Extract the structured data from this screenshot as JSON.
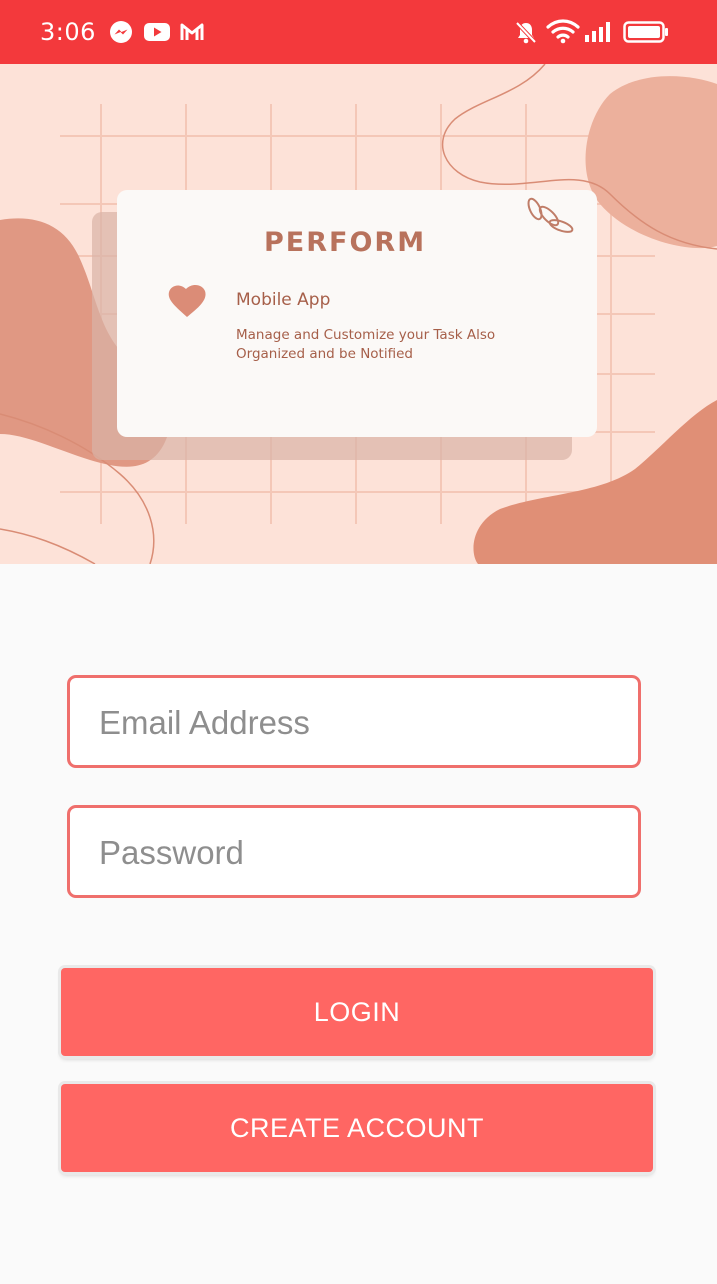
{
  "status_bar": {
    "time": "3:06",
    "background": "#f3393c",
    "notification_icons": [
      "messenger-icon",
      "youtube-icon",
      "gmail-icon"
    ],
    "system_icons": [
      "silent-bell-icon",
      "wifi-icon",
      "signal-icon",
      "battery-icon"
    ]
  },
  "hero": {
    "title": "PERFORM",
    "subtitle": "Mobile App",
    "description": "Manage and Customize your Task  Also Organized  and be Notified",
    "background": "#fde2d8"
  },
  "form": {
    "email": {
      "placeholder": "Email Address",
      "value": ""
    },
    "password": {
      "placeholder": "Password",
      "value": ""
    },
    "field_border_color": "#ef6f6c"
  },
  "buttons": {
    "login_label": "LOGIN",
    "create_account_label": "CREATE ACCOUNT",
    "color": "#ff6663"
  }
}
